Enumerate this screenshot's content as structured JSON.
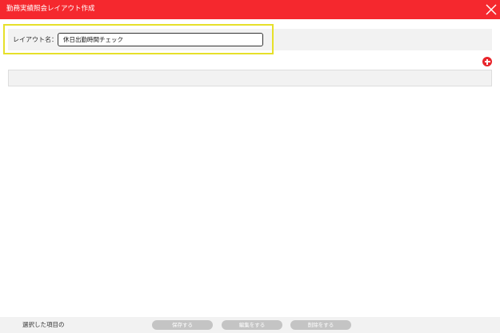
{
  "window": {
    "title": "勤務実績照会レイアウト作成",
    "title_bar_color": "#f5282e",
    "close_icon": "close-icon"
  },
  "layout_name": {
    "label": "レイアウト名：",
    "value": "休日出勤時間チェック",
    "highlight_color": "#e6e02a"
  },
  "add_button": {
    "icon": "plus-circle-icon",
    "color": "#e8252b"
  },
  "footer": {
    "selection_label": "選択した項目の",
    "save_label": "保存する",
    "edit_label": "編集をする",
    "delete_label": "削除をする"
  }
}
